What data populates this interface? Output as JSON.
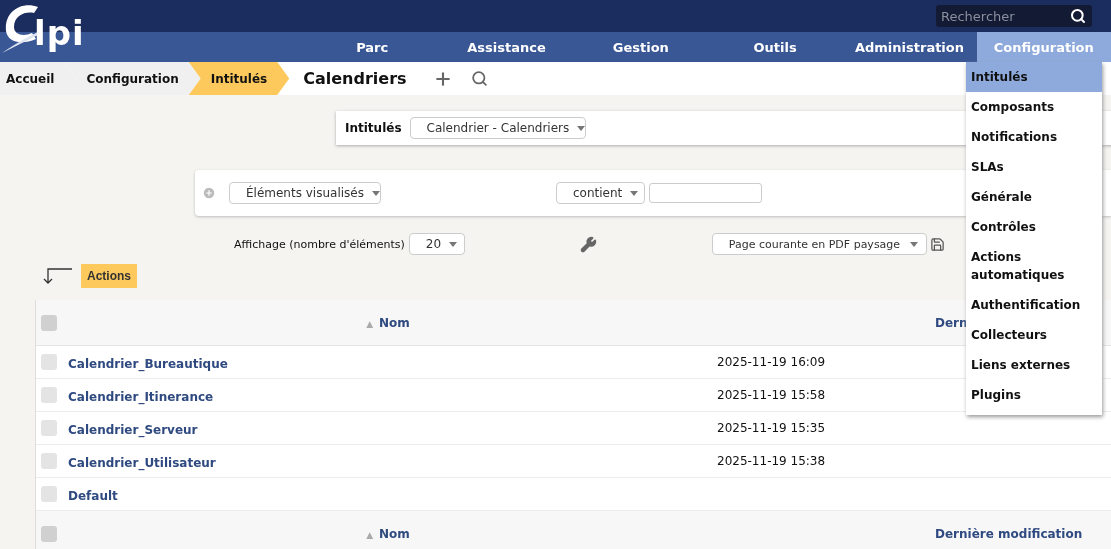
{
  "header": {
    "logo_text": "lpi",
    "search": {
      "placeholder": "Rechercher"
    }
  },
  "nav": [
    {
      "label": "Parc",
      "selected": false
    },
    {
      "label": "Assistance",
      "selected": false
    },
    {
      "label": "Gestion",
      "selected": false
    },
    {
      "label": "Outils",
      "selected": false
    },
    {
      "label": "Administration",
      "selected": false
    },
    {
      "label": "Configuration",
      "selected": true
    }
  ],
  "menu": [
    {
      "label": "Intitulés",
      "selected": true
    },
    {
      "label": "Composants",
      "selected": false
    },
    {
      "label": "Notifications",
      "selected": false
    },
    {
      "label": "SLAs",
      "selected": false
    },
    {
      "label": "Générale",
      "selected": false
    },
    {
      "label": "Contrôles",
      "selected": false
    },
    {
      "label": "Actions automatiques",
      "selected": false
    },
    {
      "label": "Authentification",
      "selected": false
    },
    {
      "label": "Collecteurs",
      "selected": false
    },
    {
      "label": "Liens externes",
      "selected": false
    },
    {
      "label": "Plugins",
      "selected": false
    }
  ],
  "breadcrumbs": [
    {
      "label": "Accueil",
      "selected": false
    },
    {
      "label": "Configuration",
      "selected": false
    },
    {
      "label": "Intitulés",
      "selected": true
    }
  ],
  "page_title": "Calendriers",
  "dropdown_card": {
    "label": "Intitulés",
    "value": "Calendrier - Calendriers"
  },
  "search_panel": {
    "field": "Éléments visualisés",
    "operator": "contient"
  },
  "display": {
    "label": "Affichage (nombre d'éléments)",
    "count": "20",
    "export": "Page courante en PDF paysage"
  },
  "actions_button": "Actions",
  "table": {
    "select_all_checked": false,
    "sort_mark": "▲",
    "columns": [
      "Nom",
      "Dern"
    ],
    "footer_columns": [
      "Nom",
      "Dernière modification"
    ],
    "rows": [
      {
        "name": "Calendrier_Bureautique",
        "modified": "2025-11-19 16:09",
        "checked": false
      },
      {
        "name": "Calendrier_Itinerance",
        "modified": "2025-11-19 15:58",
        "checked": false
      },
      {
        "name": "Calendrier_Serveur",
        "modified": "2025-11-19 15:35",
        "checked": false
      },
      {
        "name": "Calendrier_Utilisateur",
        "modified": "2025-11-19 15:38",
        "checked": false
      },
      {
        "name": "Default",
        "checked": false
      }
    ]
  }
}
